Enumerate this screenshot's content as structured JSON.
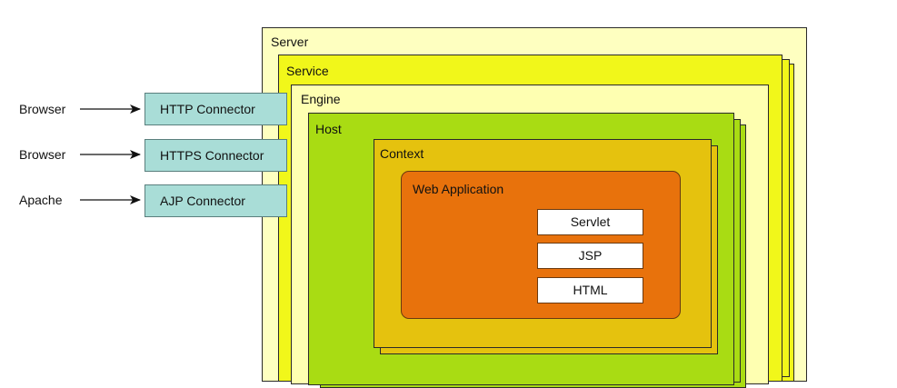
{
  "diagram": {
    "containers": {
      "server": "Server",
      "service": "Service",
      "engine": "Engine",
      "host": "Host",
      "context": "Context",
      "web_application": "Web Application"
    },
    "clients": [
      "Browser",
      "Browser",
      "Apache"
    ],
    "connectors": [
      "HTTP Connector",
      "HTTPS Connector",
      "AJP Connector"
    ],
    "components": [
      "Servlet",
      "JSP",
      "HTML"
    ]
  },
  "colors": {
    "server": "#feffc0",
    "service": "#f1f71a",
    "engine": "#feffb1",
    "host": "#a9dc13",
    "context": "#e5c20e",
    "web_application": "#e8720c",
    "connector": "#a9ddd7"
  }
}
